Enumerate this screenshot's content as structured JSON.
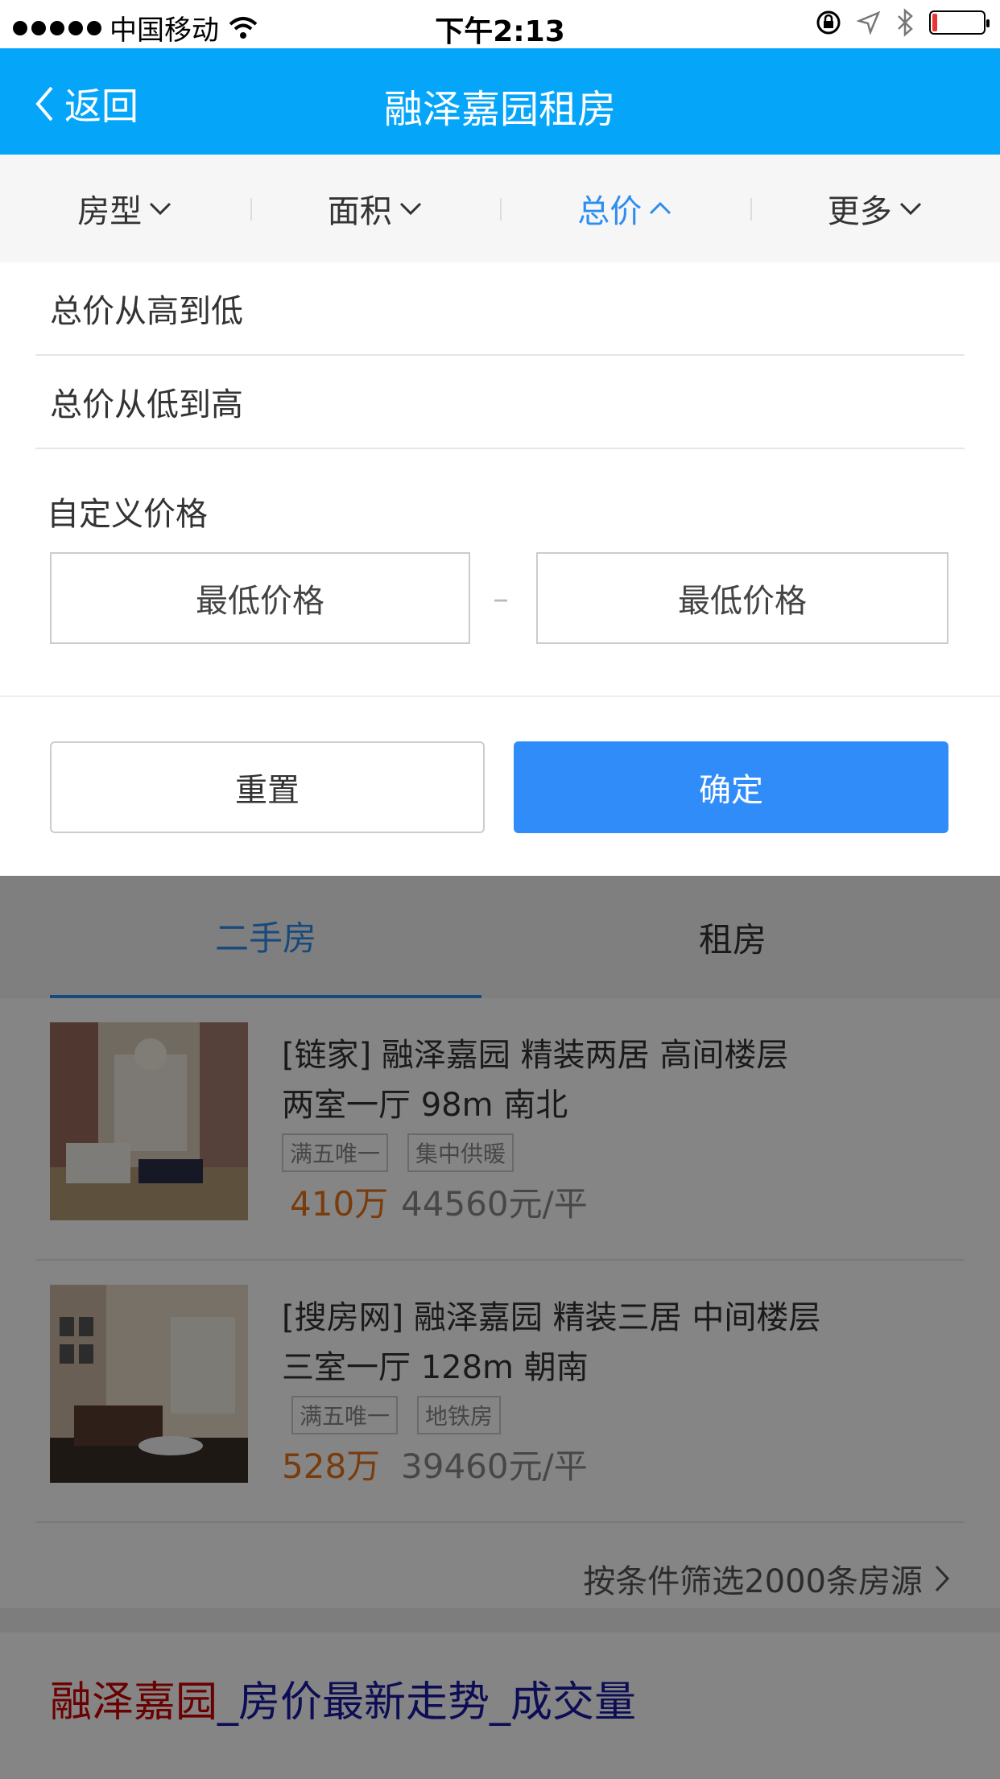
{
  "status_bar": {
    "carrier": "中国移动",
    "time": "下午2:13"
  },
  "nav": {
    "back_label": "返回",
    "title": "融泽嘉园租房"
  },
  "filters": [
    {
      "label": "房型",
      "active": false
    },
    {
      "label": "面积",
      "active": false
    },
    {
      "label": "总价",
      "active": true
    },
    {
      "label": "更多",
      "active": false
    }
  ],
  "panel": {
    "options": [
      "总价从高到低",
      "总价从低到高"
    ],
    "custom_label": "自定义价格",
    "min_placeholder": "最低价格",
    "max_placeholder": "最低价格",
    "dash": "–",
    "reset_label": "重置",
    "confirm_label": "确定"
  },
  "tabs": {
    "second_hand": "二手房",
    "rental": "租房"
  },
  "listings": [
    {
      "title": "[链家] 融泽嘉园   精装两居   高间楼层",
      "sub": "两室一厅   98m   南北",
      "tags": [
        "满五唯一",
        "集中供暖"
      ],
      "price": "410万",
      "unit_price": "44560元/平"
    },
    {
      "title": "[搜房网] 融泽嘉园   精装三居   中间楼层",
      "sub": "三室一厅   128m   朝南",
      "tags": [
        "满五唯一",
        "地铁房"
      ],
      "price": "528万",
      "unit_price": "39460元/平"
    }
  ],
  "more_link": "按条件筛选2000条房源",
  "trend": {
    "part_a": "融泽嘉园",
    "part_b": "_房价最新走势_成交量"
  },
  "colors": {
    "nav_bg": "#05a6fa",
    "accent": "#2d8ef0",
    "confirm_bg": "#2f8cf8",
    "price": "#e8731a"
  }
}
